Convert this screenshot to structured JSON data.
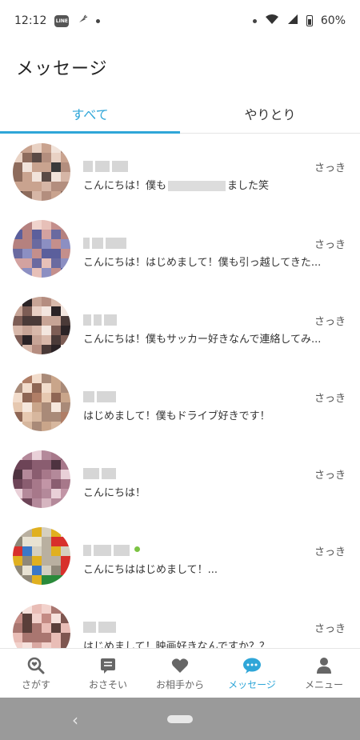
{
  "status_bar": {
    "time": "12:12",
    "line_label": "LINE",
    "battery": "60%"
  },
  "header": {
    "title": "メッセージ"
  },
  "tabs": [
    {
      "label": "すべて",
      "active": true
    },
    {
      "label": "やりとり",
      "active": false
    }
  ],
  "messages": [
    {
      "time": "さっき",
      "text": "こんにちは！僕も",
      "text_after": "ました笑"
    },
    {
      "time": "さっき",
      "text": "こんにちは！はじめまして！僕も引っ越してきた..."
    },
    {
      "time": "さっき",
      "text": "こんにちは！僕もサッカー好きなんで連絡してみ..."
    },
    {
      "time": "さっき",
      "text": "はじめまして！僕もドライブ好きです！"
    },
    {
      "time": "さっき",
      "text": "こんにちは！"
    },
    {
      "time": "さっき",
      "text": "こんにちははじめまして！..."
    },
    {
      "time": "さっき",
      "text": "はじめまして！映画好きなんですか？？"
    }
  ],
  "bottom_nav": [
    {
      "label": "さがす",
      "icon": "search-heart-icon"
    },
    {
      "label": "おさそい",
      "icon": "invitation-icon"
    },
    {
      "label": "お相手から",
      "icon": "heart-icon"
    },
    {
      "label": "メッセージ",
      "icon": "chat-bubble-icon",
      "active": true
    },
    {
      "label": "メニュー",
      "icon": "person-icon"
    }
  ],
  "colors": {
    "accent": "#2fa6d8",
    "online": "#7cc343",
    "nav_gray": "#666666"
  }
}
